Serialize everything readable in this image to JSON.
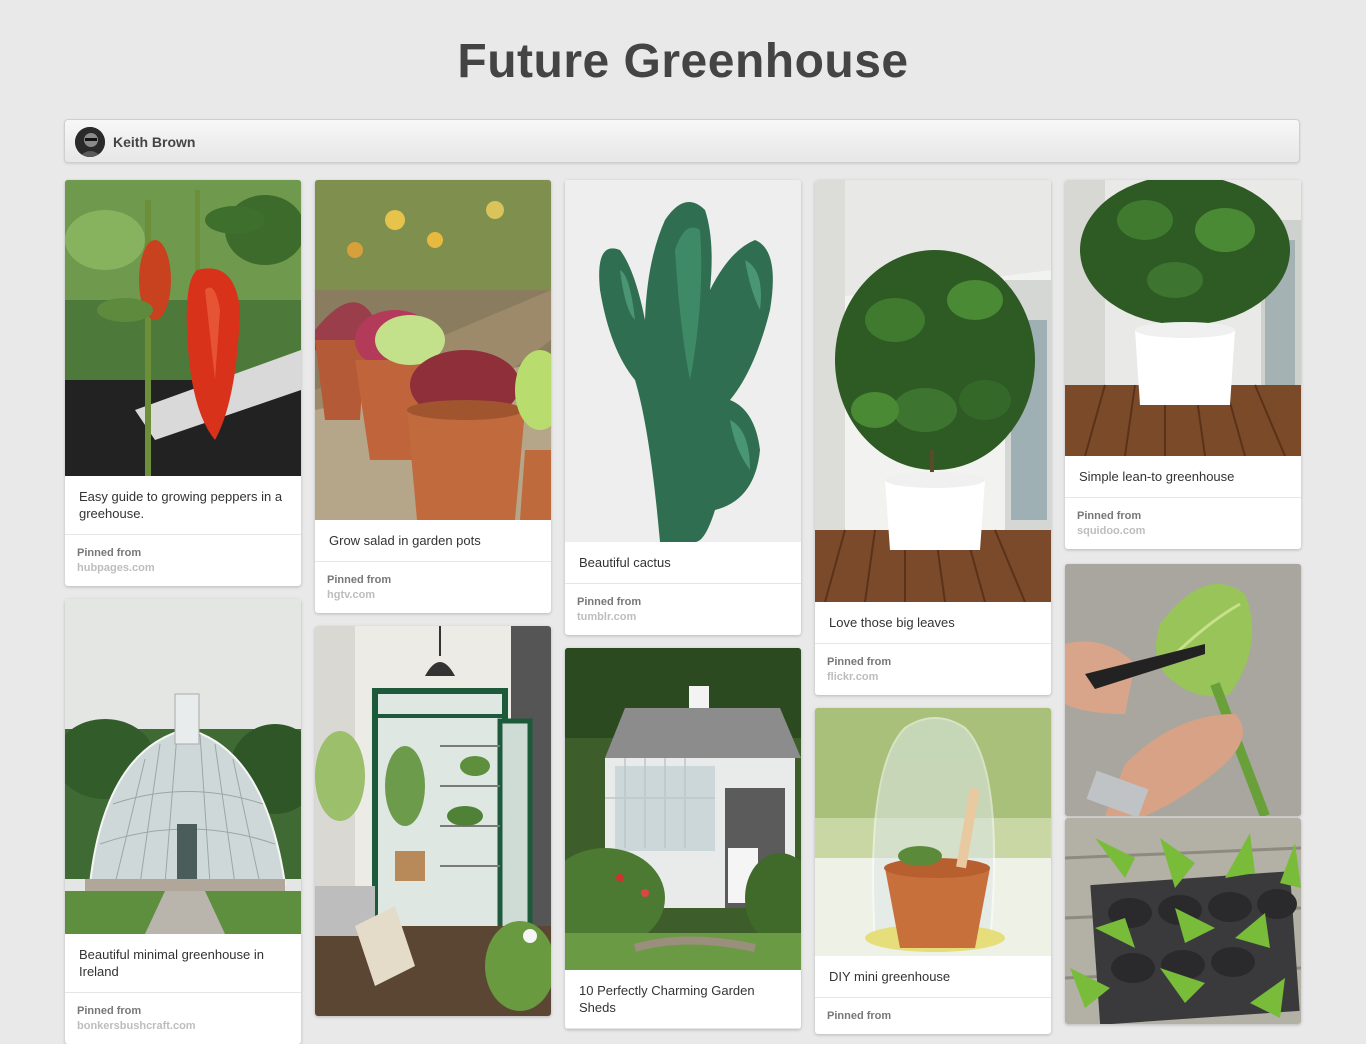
{
  "board": {
    "title": "Future Greenhouse",
    "owner": {
      "name": "Keith Brown"
    }
  },
  "pins": [
    {
      "description": "Easy guide to growing peppers in a greehouse.",
      "pinned_label": "Pinned from",
      "source": "hubpages.com"
    },
    {
      "description": "Beautiful minimal greenhouse in Ireland",
      "pinned_label": "Pinned from",
      "source": "bonkersbushcraft.com"
    },
    {
      "description": "Grow salad in garden pots",
      "pinned_label": "Pinned from",
      "source": "hgtv.com"
    },
    {
      "description": "",
      "pinned_label": "",
      "source": ""
    },
    {
      "description": "Beautiful cactus",
      "pinned_label": "Pinned from",
      "source": "tumblr.com"
    },
    {
      "description": "10 Perfectly Charming Garden Sheds",
      "pinned_label": "",
      "source": ""
    },
    {
      "description": "Love those big leaves",
      "pinned_label": "Pinned from",
      "source": "flickr.com"
    },
    {
      "description": "DIY mini greenhouse",
      "pinned_label": "Pinned from",
      "source": ""
    },
    {
      "description": "Simple lean-to greenhouse",
      "pinned_label": "Pinned from",
      "source": "squidoo.com"
    },
    {
      "description": "",
      "pinned_label": "",
      "source": ""
    },
    {
      "description": "",
      "pinned_label": "",
      "source": ""
    }
  ],
  "icons": {
    "avatar": "user-avatar-photo"
  },
  "colors": {
    "background": "#e9e9e9",
    "title": "#444444",
    "card": "#ffffff",
    "source_text": "#bdbdbd"
  }
}
